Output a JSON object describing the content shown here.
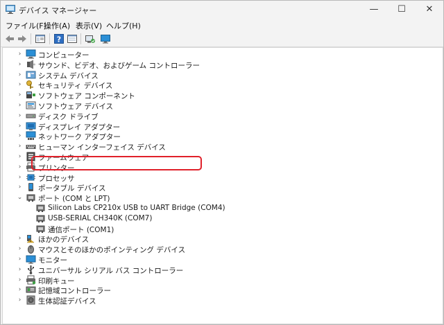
{
  "window": {
    "title": "デバイス マネージャー",
    "minimize_glyph": "—",
    "maximize_glyph": "☐",
    "close_glyph": "✕"
  },
  "menu": {
    "items": [
      "ファイル(F)",
      "操作(A)",
      "表示(V)",
      "ヘルプ(H)"
    ]
  },
  "toolbar": {
    "buttons": [
      "back-arrow-icon",
      "forward-arrow-icon",
      "properties-icon",
      "help-icon",
      "details-icon",
      "scan-hardware-icon",
      "monitor-icon"
    ]
  },
  "tree": {
    "categories": [
      {
        "label": "コンピューター",
        "icon": "computer-icon",
        "expanded": false
      },
      {
        "label": "サウンド、ビデオ、およびゲーム コントローラー",
        "icon": "sound-icon",
        "expanded": false
      },
      {
        "label": "システム デバイス",
        "icon": "system-device-icon",
        "expanded": false
      },
      {
        "label": "セキュリティ デバイス",
        "icon": "security-key-icon",
        "expanded": false
      },
      {
        "label": "ソフトウェア コンポーネント",
        "icon": "software-component-icon",
        "expanded": false
      },
      {
        "label": "ソフトウェア デバイス",
        "icon": "software-device-icon",
        "expanded": false
      },
      {
        "label": "ディスク ドライブ",
        "icon": "disk-drive-icon",
        "expanded": false
      },
      {
        "label": "ディスプレイ アダプター",
        "icon": "display-adapter-icon",
        "expanded": false
      },
      {
        "label": "ネットワーク アダプター",
        "icon": "network-adapter-icon",
        "expanded": false
      },
      {
        "label": "ヒューマン インターフェイス デバイス",
        "icon": "hid-icon",
        "expanded": false
      },
      {
        "label": "ファームウェア",
        "icon": "firmware-icon",
        "expanded": false
      },
      {
        "label": "プリンター",
        "icon": "printer-icon",
        "expanded": false
      },
      {
        "label": "プロセッサ",
        "icon": "processor-icon",
        "expanded": false
      },
      {
        "label": "ポータブル デバイス",
        "icon": "portable-device-icon",
        "expanded": false
      },
      {
        "label": "ポート (COM と LPT)",
        "icon": "port-icon",
        "expanded": true
      },
      {
        "label": "Silicon Labs CP210x USB to UART Bridge (COM4)",
        "icon": "port-icon",
        "child": true
      },
      {
        "label": "USB-SERIAL CH340K (COM7)",
        "icon": "port-icon",
        "child": true
      },
      {
        "label": "通信ポート (COM1)",
        "icon": "port-icon",
        "child": true
      },
      {
        "label": "ほかのデバイス",
        "icon": "unknown-device-icon",
        "expanded": false
      },
      {
        "label": "マウスとそのほかのポインティング デバイス",
        "icon": "mouse-icon",
        "expanded": false
      },
      {
        "label": "モニター",
        "icon": "monitor-icon",
        "expanded": false
      },
      {
        "label": "ユニバーサル シリアル バス コントローラー",
        "icon": "usb-icon",
        "expanded": false
      },
      {
        "label": "印刷キュー",
        "icon": "print-queue-icon",
        "expanded": false
      },
      {
        "label": "記憶域コントローラー",
        "icon": "storage-controller-icon",
        "expanded": false
      },
      {
        "label": "生体認証デバイス",
        "icon": "biometric-icon",
        "expanded": false
      }
    ]
  },
  "colors": {
    "highlight": "#e0202a",
    "monitor_blue": "#2b8fd6"
  }
}
